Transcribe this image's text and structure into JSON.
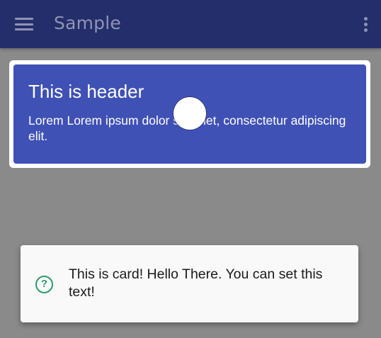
{
  "appbar": {
    "title": "Sample",
    "menu_icon": "hamburger-menu-icon",
    "overflow_icon": "more-vert-icon"
  },
  "header_card": {
    "title": "This is header",
    "body": "Lorem Lorem ipsum dolor sit amet, consectetur adipiscing elit."
  },
  "snack_card": {
    "icon": "help-circle-icon",
    "text": "This is card! Hello There. You can set this text!"
  },
  "colors": {
    "appbar": "#242e6a",
    "header_card": "#3f51b5",
    "scrim": "#8a8a8a",
    "help_icon": "#2e9d6a"
  }
}
